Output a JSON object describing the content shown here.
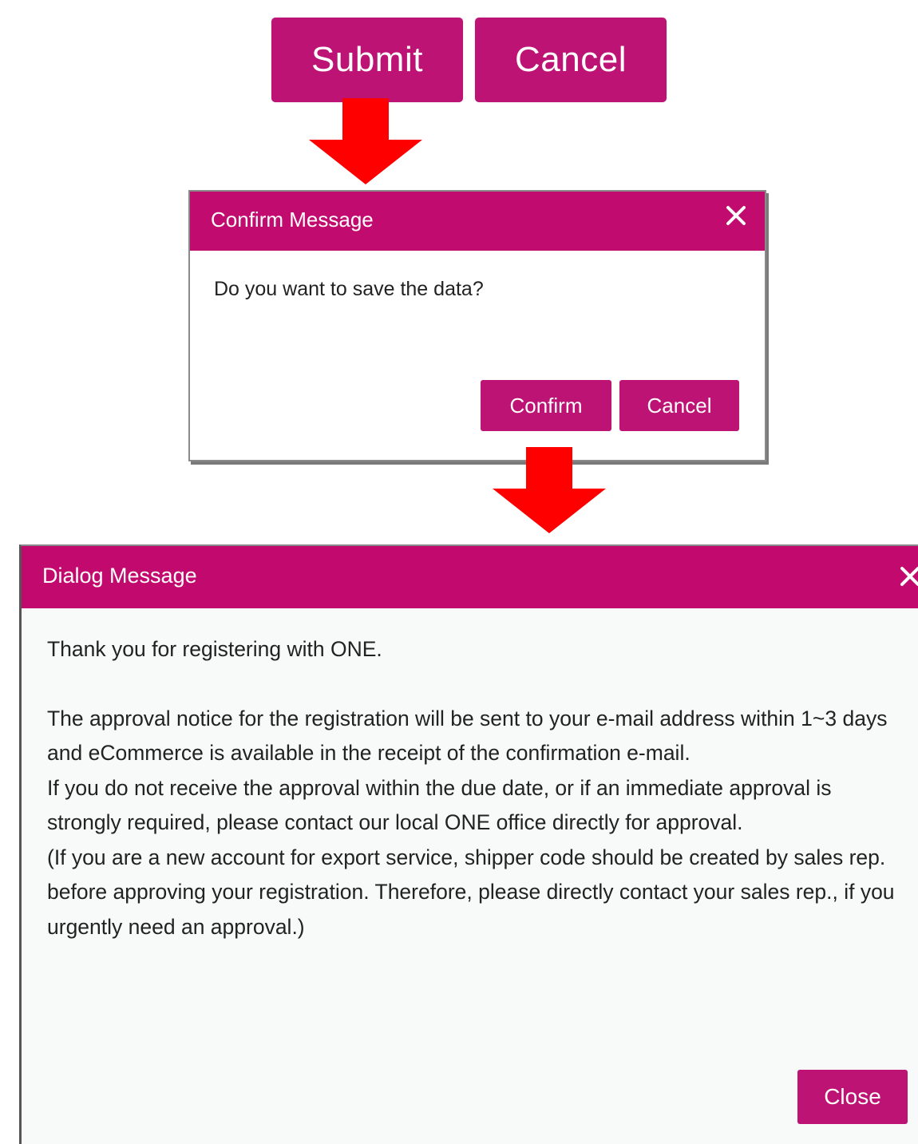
{
  "top_buttons": {
    "submit_label": "Submit",
    "cancel_label": "Cancel"
  },
  "confirm_dialog": {
    "title": "Confirm Message",
    "close_icon": "close-icon",
    "message": "Do you want to save the data?",
    "confirm_label": "Confirm",
    "cancel_label": "Cancel"
  },
  "message_dialog": {
    "title": "Dialog Message",
    "close_icon": "close-icon",
    "paragraphs": [
      "Thank you for registering with ONE.",
      "The approval notice for the registration will be sent to your e-mail address within 1~3 days and eCommerce is available in the receipt of the confirmation e-mail.",
      "If you do not receive the approval within the due date, or if an immediate approval is strongly required, please contact our local ONE office directly for approval.",
      "(If you are a new account for export service, shipper code should be created by sales rep. before approving your registration. Therefore, please directly contact your sales rep., if you urgently need an approval.)"
    ],
    "close_label": "Close"
  },
  "colors": {
    "brand": "#bc1374",
    "header": "#c20b6f",
    "arrow": "#ff0000"
  }
}
